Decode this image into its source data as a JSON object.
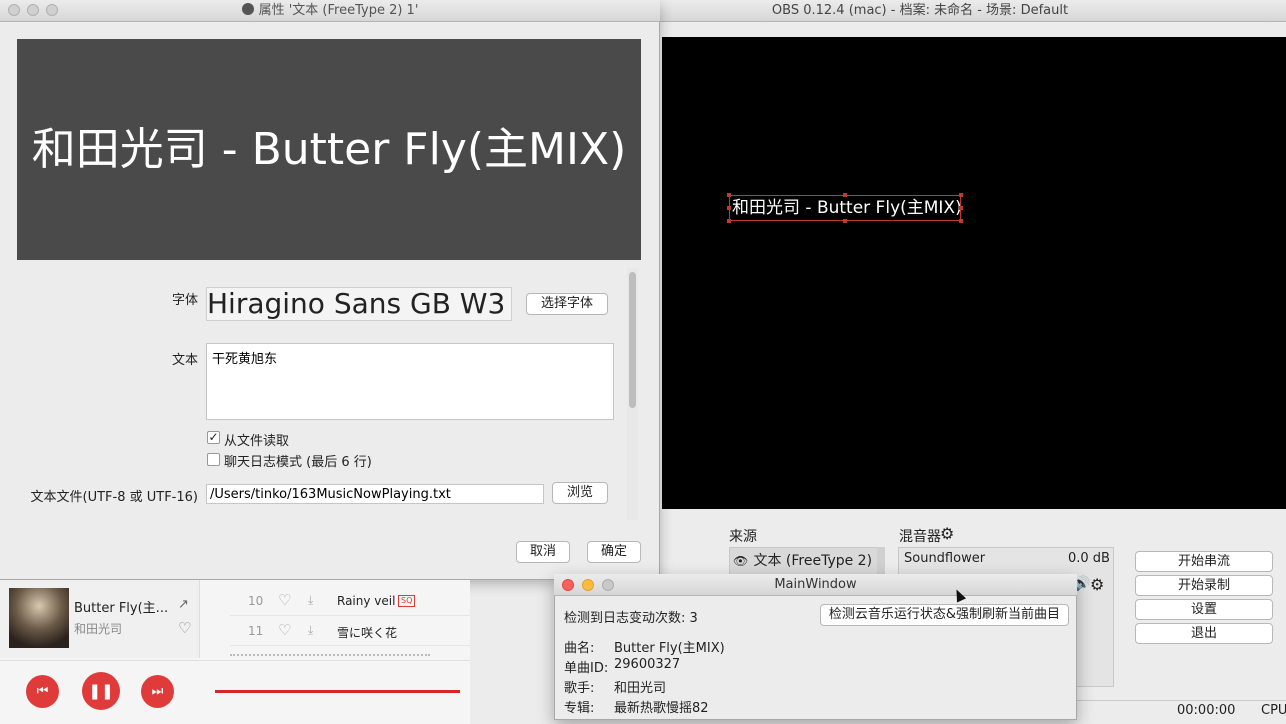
{
  "obs": {
    "window_title": "OBS 0.12.4 (mac) - 档案: 未命名 - 场景: Default",
    "preview_text": "和田光司 - Butter Fly(主MIX)",
    "sources_label": "来源",
    "source_item": "文本 (FreeType 2) 1",
    "mixer_label": "混音器",
    "mixer_device": "Soundflower",
    "mixer_level": "0.0 dB",
    "buttons": {
      "start_stream": "开始串流",
      "start_record": "开始录制",
      "settings": "设置",
      "exit": "退出"
    },
    "status_time": "00:00:00",
    "status_cpu": "CPU"
  },
  "props": {
    "title": "属性 '文本 (FreeType 2) 1'",
    "preview_text": "和田光司 - Butter Fly(主MIX)",
    "font_label": "字体",
    "font_sample": "Hiragino Sans GB W3",
    "choose_font": "选择字体",
    "text_label": "文本",
    "text_value": "干死黄旭东",
    "read_from_file": "从文件读取",
    "chat_log_mode": "聊天日志模式 (最后 6 行)",
    "file_label": "文本文件(UTF-8 或 UTF-16)",
    "file_path": "/Users/tinko/163MusicNowPlaying.txt",
    "browse": "浏览",
    "cancel": "取消",
    "ok": "确定"
  },
  "music": {
    "song_title": "Butter Fly(主...",
    "artist": "和田光司",
    "tracks": [
      {
        "num": "10",
        "name": "Rainy veil",
        "badge": "SQ"
      },
      {
        "num": "11",
        "name": "雪に咲く花",
        "badge": ""
      }
    ]
  },
  "mainwindow": {
    "title": "MainWindow",
    "log_change_label": "检测到日志变动次数: ",
    "log_change_count": "3",
    "refresh_button": "检测云音乐运行状态&强制刷新当前曲目",
    "song_label": "曲名:",
    "song_value": "Butter Fly(主MIX)",
    "id_label": "单曲ID:",
    "id_value": "29600327",
    "artist_label": "歌手:",
    "artist_value": "和田光司",
    "album_label": "专辑:",
    "album_value": "最新热歌慢摇82"
  },
  "colors": {
    "accent_red": "#e03b3b",
    "preview_bg": "#000000",
    "close_light": "#fc605b",
    "min_light": "#fdbc40",
    "max_light": "#c8c8c8"
  }
}
